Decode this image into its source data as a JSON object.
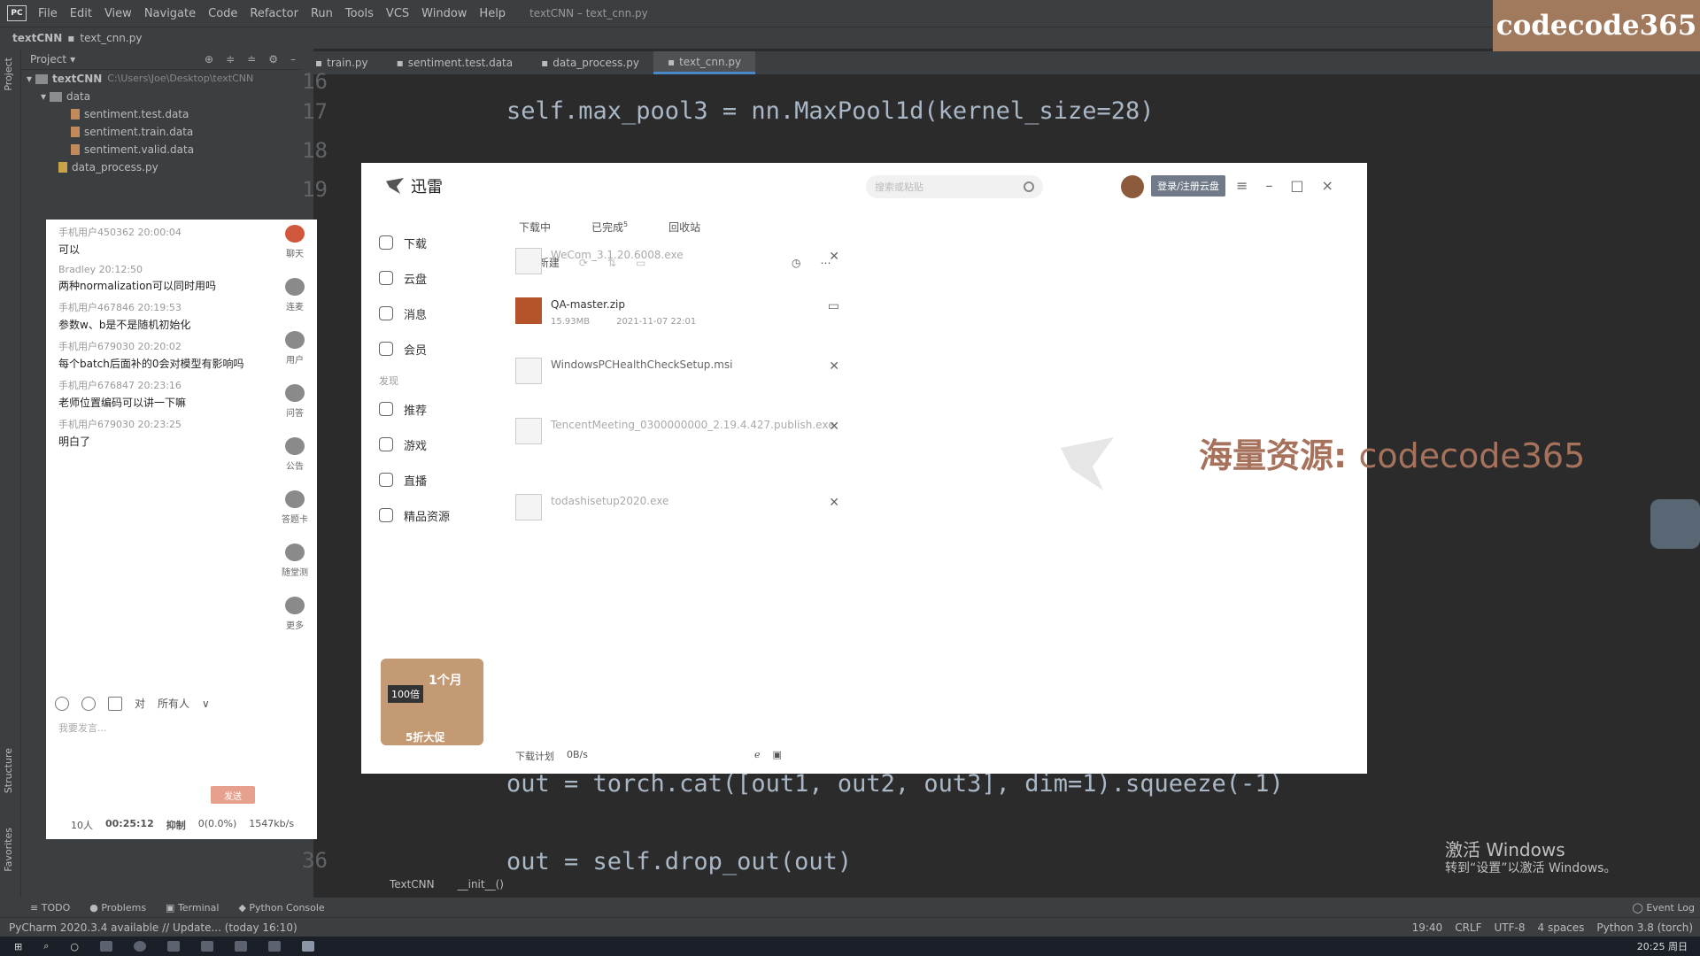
{
  "menu": {
    "items": [
      "File",
      "Edit",
      "View",
      "Navigate",
      "Code",
      "Refactor",
      "Run",
      "Tools",
      "VCS",
      "Window",
      "Help"
    ],
    "window_title": "textCNN – text_cnn.py"
  },
  "navbar": {
    "project": "textCNN",
    "file": "text_cnn.py"
  },
  "brand": "codecode365",
  "side_labels": {
    "project": "Project",
    "structure": "Structure",
    "favorites": "Favorites"
  },
  "project_panel": {
    "title": "Project",
    "root": {
      "name": "textCNN",
      "path": "C:\\Users\\Joe\\Desktop\\textCNN"
    },
    "folder": "data",
    "files": [
      "sentiment.test.data",
      "sentiment.train.data",
      "sentiment.valid.data"
    ],
    "extra_file": "data_process.py"
  },
  "editor_tabs": [
    "train.py",
    "sentiment.test.data",
    "data_process.py",
    "text_cnn.py"
  ],
  "editor": {
    "line_numbers": [
      "16",
      "17",
      "18",
      "19",
      "36"
    ],
    "line17": "self.max_pool3 = nn.MaxPool1d(kernel_size=28)",
    "line_cat": "out = torch.cat([out1, out2, out3], dim=1).squeeze(-1)",
    "line_drop": "out = self.drop_out(out)",
    "breadcrumb": [
      "TextCNN",
      "__init__()"
    ]
  },
  "chat": {
    "messages": [
      {
        "user": "手机用户450362",
        "time": "20:00:04",
        "text": "可以"
      },
      {
        "user": "Bradley",
        "time": "20:12:50",
        "text": "两种normalization可以同时用吗"
      },
      {
        "user": "手机用户467846",
        "time": "20:19:53",
        "text": "参数w、b是不是随机初始化"
      },
      {
        "user": "手机用户679030",
        "time": "20:20:02",
        "text": "每个batch后面补的0会对模型有影响吗"
      },
      {
        "user": "手机用户676847",
        "time": "20:23:16",
        "text": "老师位置编码可以讲一下嘛"
      },
      {
        "user": "手机用户679030",
        "time": "20:23:25",
        "text": "明白了"
      }
    ],
    "side": [
      "聊天",
      "连麦",
      "用户",
      "问答",
      "公告",
      "答题卡",
      "随堂测",
      "更多"
    ],
    "toolbar_to": "对",
    "toolbar_target": "所有人",
    "input_placeholder": "我要发言...",
    "send": "发送",
    "footer": {
      "people": "10人",
      "duration": "00:25:12",
      "status": "抑制",
      "loss": "0(0.0%)",
      "rate": "1547kb/s"
    }
  },
  "xunlei": {
    "title": "迅雷",
    "search_placeholder": "搜索或粘贴",
    "login": "登录/注册云盘",
    "nav": [
      {
        "label": "下载",
        "icon": "download-icon"
      },
      {
        "label": "云盘",
        "icon": "cloud-icon"
      },
      {
        "label": "消息",
        "icon": "message-icon"
      },
      {
        "label": "会员",
        "icon": "vip-icon"
      }
    ],
    "nav_group": "发现",
    "nav2": [
      {
        "label": "推荐",
        "icon": "recommend-icon"
      },
      {
        "label": "游戏",
        "icon": "game-icon"
      },
      {
        "label": "直播",
        "icon": "live-icon"
      },
      {
        "label": "精品资源",
        "icon": "resource-icon"
      }
    ],
    "tabs": [
      "下载中",
      "已完成",
      "回收站"
    ],
    "completed_count": "5",
    "new_task": "+ 新建",
    "downloads": [
      {
        "name": "WeCom_3.1.20.6008.exe",
        "size": "",
        "date": "",
        "faded": true,
        "action": "close-icon"
      },
      {
        "name": "QA-master.zip",
        "size": "15.93MB",
        "date": "2021-11-07 22:01",
        "faded": false,
        "action": "folder-icon"
      },
      {
        "name": "WindowsPCHealthCheckSetup.msi",
        "size": "",
        "date": "",
        "faded": false,
        "action": "close-icon"
      },
      {
        "name": "TencentMeeting_0300000000_2.19.4.427.publish.exe",
        "size": "",
        "date": "",
        "faded": true,
        "action": "close-icon"
      },
      {
        "name": "todashisetup2020.exe",
        "size": "",
        "date": "",
        "faded": true,
        "action": "close-icon"
      }
    ],
    "vip_banner": {
      "badge": "100倍",
      "months": "1个月",
      "btn": "5折大促"
    },
    "footer_plan": "下载计划",
    "footer_speed": "0B/s"
  },
  "ad_text": {
    "prefix": "海量资源:",
    "suffix": "codecode365"
  },
  "win_activate": {
    "title": "激活 Windows",
    "sub": "转到“设置”以激活 Windows。"
  },
  "toolwindows": [
    "TODO",
    "Problems",
    "Terminal",
    "Python Console"
  ],
  "event_log": "Event Log",
  "status": {
    "left": "PyCharm 2020.3.4 available // Update... (today 16:10)",
    "pos": "19:40",
    "eol": "CRLF",
    "enc": "UTF-8",
    "indent": "4 spaces",
    "interp": "Python 3.8 (torch)"
  },
  "taskbar": {
    "time": "20:25 周日"
  }
}
